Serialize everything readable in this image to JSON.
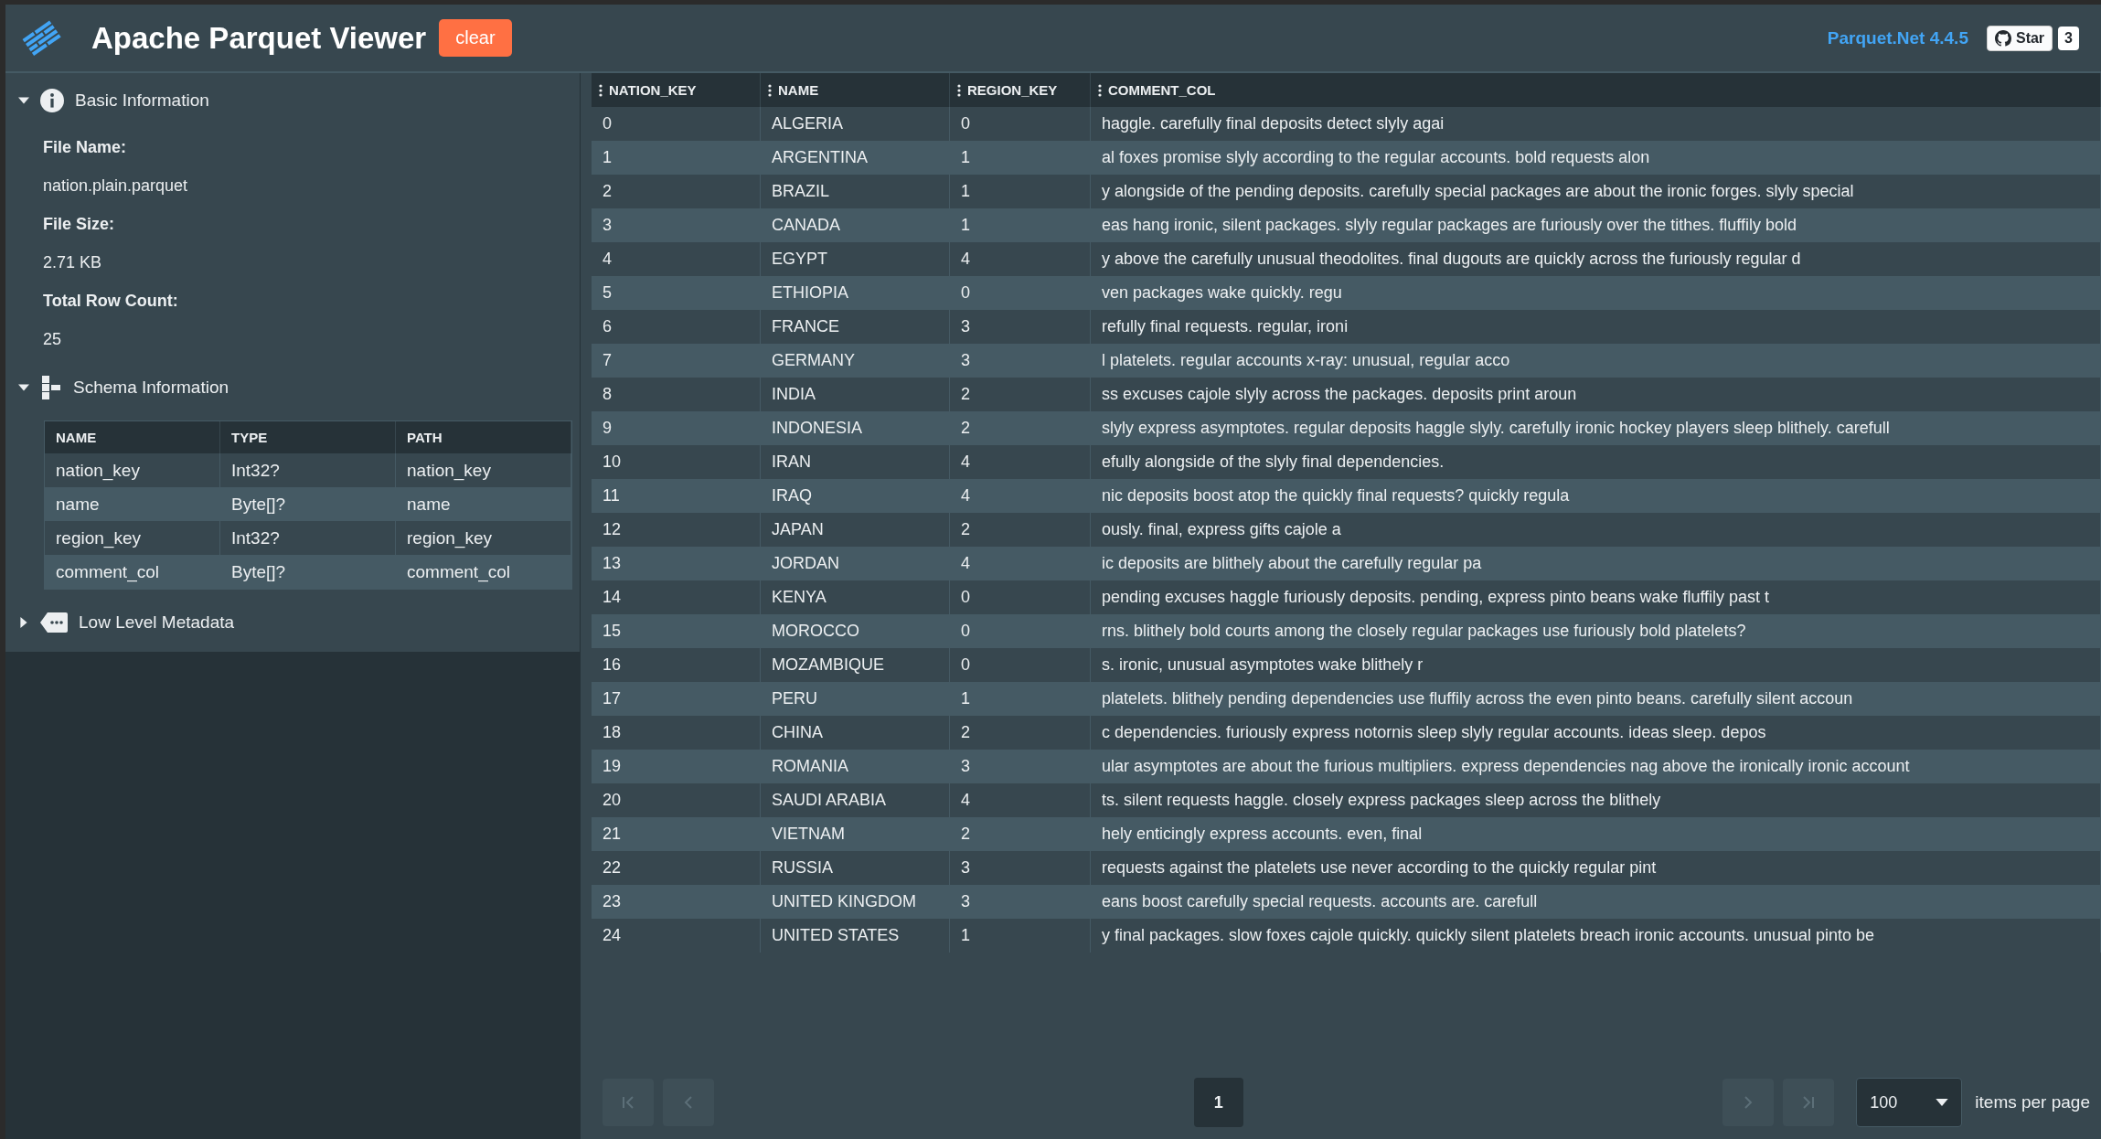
{
  "header": {
    "title": "Apache Parquet Viewer",
    "clear_button": "clear",
    "version_link": "Parquet.Net 4.4.5",
    "star_button": "Star",
    "star_count": "3"
  },
  "sidebar": {
    "sections": [
      {
        "kind": "info",
        "title": "Basic Information",
        "expanded": true,
        "fields": [
          {
            "label": "File Name:",
            "value": "nation.plain.parquet"
          },
          {
            "label": "File Size:",
            "value": "2.71 KB"
          },
          {
            "label": "Total Row Count:",
            "value": "25"
          }
        ]
      },
      {
        "kind": "schema",
        "title": "Schema Information",
        "expanded": true,
        "columns": [
          "NAME",
          "TYPE",
          "PATH"
        ],
        "rows": [
          [
            "nation_key",
            "Int32?",
            "nation_key"
          ],
          [
            "name",
            "Byte[]?",
            "name"
          ],
          [
            "region_key",
            "Int32?",
            "region_key"
          ],
          [
            "comment_col",
            "Byte[]?",
            "comment_col"
          ]
        ]
      },
      {
        "kind": "metadata",
        "title": "Low Level Metadata",
        "expanded": false
      }
    ]
  },
  "table": {
    "columns": [
      "NATION_KEY",
      "NAME",
      "REGION_KEY",
      "COMMENT_COL"
    ],
    "rows": [
      [
        "0",
        "ALGERIA",
        "0",
        "haggle. carefully final deposits detect slyly agai"
      ],
      [
        "1",
        "ARGENTINA",
        "1",
        "al foxes promise slyly according to the regular accounts. bold requests alon"
      ],
      [
        "2",
        "BRAZIL",
        "1",
        "y alongside of the pending deposits. carefully special packages are about the ironic forges. slyly special"
      ],
      [
        "3",
        "CANADA",
        "1",
        "eas hang ironic, silent packages. slyly regular packages are furiously over the tithes. fluffily bold"
      ],
      [
        "4",
        "EGYPT",
        "4",
        "y above the carefully unusual theodolites. final dugouts are quickly across the furiously regular d"
      ],
      [
        "5",
        "ETHIOPIA",
        "0",
        "ven packages wake quickly. regu"
      ],
      [
        "6",
        "FRANCE",
        "3",
        "refully final requests. regular, ironi"
      ],
      [
        "7",
        "GERMANY",
        "3",
        "l platelets. regular accounts x-ray: unusual, regular acco"
      ],
      [
        "8",
        "INDIA",
        "2",
        "ss excuses cajole slyly across the packages. deposits print aroun"
      ],
      [
        "9",
        "INDONESIA",
        "2",
        "slyly express asymptotes. regular deposits haggle slyly. carefully ironic hockey players sleep blithely. carefull"
      ],
      [
        "10",
        "IRAN",
        "4",
        "efully alongside of the slyly final dependencies."
      ],
      [
        "11",
        "IRAQ",
        "4",
        "nic deposits boost atop the quickly final requests? quickly regula"
      ],
      [
        "12",
        "JAPAN",
        "2",
        "ously. final, express gifts cajole a"
      ],
      [
        "13",
        "JORDAN",
        "4",
        "ic deposits are blithely about the carefully regular pa"
      ],
      [
        "14",
        "KENYA",
        "0",
        "pending excuses haggle furiously deposits. pending, express pinto beans wake fluffily past t"
      ],
      [
        "15",
        "MOROCCO",
        "0",
        "rns. blithely bold courts among the closely regular packages use furiously bold platelets?"
      ],
      [
        "16",
        "MOZAMBIQUE",
        "0",
        "s. ironic, unusual asymptotes wake blithely r"
      ],
      [
        "17",
        "PERU",
        "1",
        "platelets. blithely pending dependencies use fluffily across the even pinto beans. carefully silent accoun"
      ],
      [
        "18",
        "CHINA",
        "2",
        "c dependencies. furiously express notornis sleep slyly regular accounts. ideas sleep. depos"
      ],
      [
        "19",
        "ROMANIA",
        "3",
        "ular asymptotes are about the furious multipliers. express dependencies nag above the ironically ironic account"
      ],
      [
        "20",
        "SAUDI ARABIA",
        "4",
        "ts. silent requests haggle. closely express packages sleep across the blithely"
      ],
      [
        "21",
        "VIETNAM",
        "2",
        "hely enticingly express accounts. even, final"
      ],
      [
        "22",
        "RUSSIA",
        "3",
        "requests against the platelets use never according to the quickly regular pint"
      ],
      [
        "23",
        "UNITED KINGDOM",
        "3",
        "eans boost carefully special requests. accounts are. carefull"
      ],
      [
        "24",
        "UNITED STATES",
        "1",
        "y final packages. slow foxes cajole quickly. quickly silent platelets breach ironic accounts. unusual pinto be"
      ]
    ]
  },
  "pagination": {
    "first_disabled": true,
    "prev_disabled": true,
    "next_disabled": true,
    "last_disabled": true,
    "pages": [
      {
        "label": "1",
        "selected": true
      }
    ],
    "page_size": "100",
    "page_size_label": "items per page"
  }
}
